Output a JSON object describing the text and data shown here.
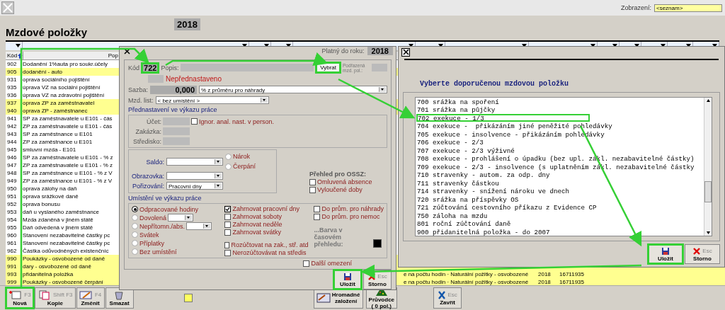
{
  "top_bar": {
    "display_label": "Zobrazení:",
    "display_value": "<seznam>"
  },
  "title": "Mzdové položky",
  "year": "2018",
  "list": {
    "columns": [
      "Kód",
      "Pop"
    ],
    "rows": [
      {
        "code": "902",
        "text": "Dodanění 1%auta pro soukr.účely",
        "highlighted": false
      },
      {
        "code": "905",
        "text": "dodanění - auto",
        "highlighted": true
      },
      {
        "code": "931",
        "text": "oprava sociálního pojištění",
        "highlighted": false
      },
      {
        "code": "935",
        "text": "úprava VZ na sociální pojištění",
        "highlighted": false
      },
      {
        "code": "936",
        "text": "úprava VZ na zdravotní pojištění",
        "highlighted": false
      },
      {
        "code": "937",
        "text": "oprava ZP za zaměstnavatel",
        "highlighted": true
      },
      {
        "code": "940",
        "text": "oprava ZP - zaměstnanec",
        "highlighted": true
      },
      {
        "code": "941",
        "text": "SP za zaměstnavatele u E101 - čás",
        "highlighted": false
      },
      {
        "code": "942",
        "text": "ZP za zaměstnavatele u E101 - čás",
        "highlighted": false
      },
      {
        "code": "943",
        "text": "SP za zaměstnance u E101",
        "highlighted": false
      },
      {
        "code": "944",
        "text": "ZP za zaměstnance u E101",
        "highlighted": false
      },
      {
        "code": "945",
        "text": "smluvní mzda - E101",
        "highlighted": false
      },
      {
        "code": "946",
        "text": "SP za zaměstnavatele u E101 - % z",
        "highlighted": false
      },
      {
        "code": "947",
        "text": "ZP za zaměstnavatele u E101 - % z",
        "highlighted": false
      },
      {
        "code": "948",
        "text": "SP za zaměstnance u E101 - % z V",
        "highlighted": false
      },
      {
        "code": "949",
        "text": "ZP za zaměstnance u E101 - % z V",
        "highlighted": false
      },
      {
        "code": "950",
        "text": "oprava zálohy na daň",
        "highlighted": false
      },
      {
        "code": "951",
        "text": "oprava srážkové daně",
        "highlighted": false
      },
      {
        "code": "952",
        "text": "oprava bonusu",
        "highlighted": false
      },
      {
        "code": "953",
        "text": "daň u vyslaného zaměstnance",
        "highlighted": false
      },
      {
        "code": "954",
        "text": "Mzda zdaněná v jiném státě",
        "highlighted": false
      },
      {
        "code": "955",
        "text": "Daň odvedená v jiném státě",
        "highlighted": false
      },
      {
        "code": "960",
        "text": "Stanovení nezabavitelné částky pc",
        "highlighted": false
      },
      {
        "code": "961",
        "text": "Stanovení nezabavitelné částky pc",
        "highlighted": false
      },
      {
        "code": "962",
        "text": "Částka odůvodněných existenčníc",
        "highlighted": false
      },
      {
        "code": "990",
        "text": "Poukázky - osvobozené od daně",
        "highlighted": true
      },
      {
        "code": "991",
        "text": "dary - osvobozené od daně",
        "highlighted": true
      },
      {
        "code": "993",
        "text": "přidanitelná položka",
        "highlighted": true,
        "detail": "e na počtu hodin · Naturální požitky - osvobozené",
        "detail_year": "2018",
        "detail_number": "16711935"
      },
      {
        "code": "999",
        "text": "Poukázky - osvobozené čerpání",
        "highlighted": true,
        "detail": "e na počtu hodin · Naturální požitky - osvobozené",
        "detail_year": "2018",
        "detail_number": "16711935"
      }
    ]
  },
  "edit_dialog": {
    "valid_label": "Platný do roku:",
    "valid_year": "2018",
    "code_label": "Kód",
    "code": "722",
    "code_highlighted": true,
    "desc_label": "Popis:",
    "select_button": {
      "label": "Vybrat",
      "highlighted": true
    },
    "parent_label": "Podřazená mzd. pol.:",
    "status": "Nepřednastaveno",
    "rate_label": "Sazba:",
    "rate": "0,000",
    "rate_unit": "% z průměru pro náhrady",
    "sheet_label": "Mzd. list:",
    "sheet_value": "< bez umístění >",
    "preset_title": "Přednastavení ve výkazu práce",
    "preset_fields": [
      "Účet:",
      "Zakázka:",
      "Středisko:"
    ],
    "ignore_checkbox": {
      "label": "Ignor. anal. nast. v person.",
      "checked": false
    },
    "saldo_label": "Saldo:",
    "saldo_radios": [
      {
        "label": "Nárok",
        "selected": false
      },
      {
        "label": "Čerpání",
        "selected": false
      }
    ],
    "screen_label": "Obrazovka:",
    "entry_label": "Pořizování:",
    "entry_value": "Pracovní dny",
    "ossz_title": "Přehled pro OSSZ:",
    "ossz_checkboxes": [
      {
        "label": "Omluvená absence",
        "checked": false
      },
      {
        "label": "Vyloučené doby",
        "checked": false
      }
    ],
    "placement_title": "Umístění ve výkazu práce",
    "placement_radios": [
      {
        "label": "Odpracované hodiny",
        "selected": true,
        "has_dropdown": false
      },
      {
        "label": "Dovolená",
        "selected": false,
        "has_dropdown": true
      },
      {
        "label": "Nepřítomn./abs.",
        "selected": false,
        "has_dropdown": true
      },
      {
        "label": "Svátek",
        "selected": false,
        "has_dropdown": false
      },
      {
        "label": "Příplatky",
        "selected": false,
        "has_dropdown": false
      },
      {
        "label": "Bez umístění",
        "selected": false,
        "has_dropdown": false
      }
    ],
    "include_checkboxes": [
      {
        "label": "Zahrnovat pracovní dny",
        "checked": true
      },
      {
        "label": "Zahrnovat soboty",
        "checked": false
      },
      {
        "label": "Zahrnovat neděle",
        "checked": false
      },
      {
        "label": "Zahrnovat svátky",
        "checked": false
      }
    ],
    "split_checkboxes": [
      {
        "label": "Rozúčtovat na zak., stř. atd",
        "checked": false
      },
      {
        "label": "Nerozúčtovávat na středis",
        "checked": false
      }
    ],
    "average_checkboxes": [
      {
        "label": "Do prům. pro náhrady",
        "checked": false
      },
      {
        "label": "Do prům. pro nemoc",
        "checked": false
      }
    ],
    "color_label": "...Barva v časovém přehledu:",
    "color": "#000000",
    "more_checkbox": {
      "label": "Další omezení",
      "checked": false
    },
    "buttons": [
      {
        "kind": "save",
        "label": "Uložit",
        "highlighted": true
      },
      {
        "kind": "cancel",
        "label": "Storno",
        "key": "Esc",
        "highlighted": false
      }
    ]
  },
  "pick_dialog": {
    "heading": "Vyberte doporučenou mzdovou položku",
    "items": [
      {
        "code": "700",
        "text": "srážka na spoření",
        "selected": false
      },
      {
        "code": "701",
        "text": "srážka na půjčky",
        "selected": false
      },
      {
        "code": "702",
        "text": "exekuce - 1/3",
        "selected": true
      },
      {
        "code": "704",
        "text": "exekuce -  přikázáním jiné peněžité pohledávky",
        "selected": false
      },
      {
        "code": "705",
        "text": "exekuce - insolvence - přikázáním pohledávky",
        "selected": false
      },
      {
        "code": "706",
        "text": "exekuce - 2/3",
        "selected": false
      },
      {
        "code": "707",
        "text": "exekuce - 2/3 výživné",
        "selected": false
      },
      {
        "code": "708",
        "text": "exekuce - prohlášení o úpadku (bez upl. zákl. nezabavitelné částky)",
        "selected": false
      },
      {
        "code": "709",
        "text": "exekuce - 2/3 - insolvence (s uplatněním zákl. nezabavitelné částky",
        "selected": false
      },
      {
        "code": "710",
        "text": "stravenky - autom. za odp. dny",
        "selected": false
      },
      {
        "code": "711",
        "text": "stravenky částkou",
        "selected": false
      },
      {
        "code": "714",
        "text": "stravenky - snížení nároku ve dnech",
        "selected": false
      },
      {
        "code": "720",
        "text": "srážka na příspěvky OS",
        "selected": false
      },
      {
        "code": "721",
        "text": "zúčtování cestovního příkazu z Evidence CP",
        "selected": false
      },
      {
        "code": "750",
        "text": "záloha na mzdu",
        "selected": false
      },
      {
        "code": "801",
        "text": "roční zúčtování daně",
        "selected": false
      },
      {
        "code": "900",
        "text": "přidanitelná položka - do 2007",
        "selected": false
      }
    ],
    "buttons": [
      {
        "kind": "save",
        "label": "Uložit",
        "highlighted": true
      },
      {
        "kind": "cancel",
        "label": "Storno",
        "key": "Esc",
        "highlighted": false
      }
    ]
  },
  "toolbar": [
    {
      "kind": "new",
      "label": "Nová",
      "key": "F3",
      "highlighted": true
    },
    {
      "kind": "copy",
      "label": "Kopie",
      "key": "Shift F3",
      "highlighted": false
    },
    {
      "kind": "edit",
      "label": "Změnit",
      "key": "F4",
      "highlighted": false
    },
    {
      "kind": "delete",
      "label": "Smazat",
      "highlighted": false
    },
    {
      "kind": "marker"
    },
    {
      "kind": "bulk",
      "label": "Hromadné založení",
      "highlighted": false
    },
    {
      "kind": "wizard",
      "label": "Průvodce",
      "sub": "( 0 pol.)",
      "highlighted": false
    },
    {
      "kind": "cancel",
      "label": "Zavřít",
      "key": "Esc",
      "highlighted": false
    }
  ]
}
